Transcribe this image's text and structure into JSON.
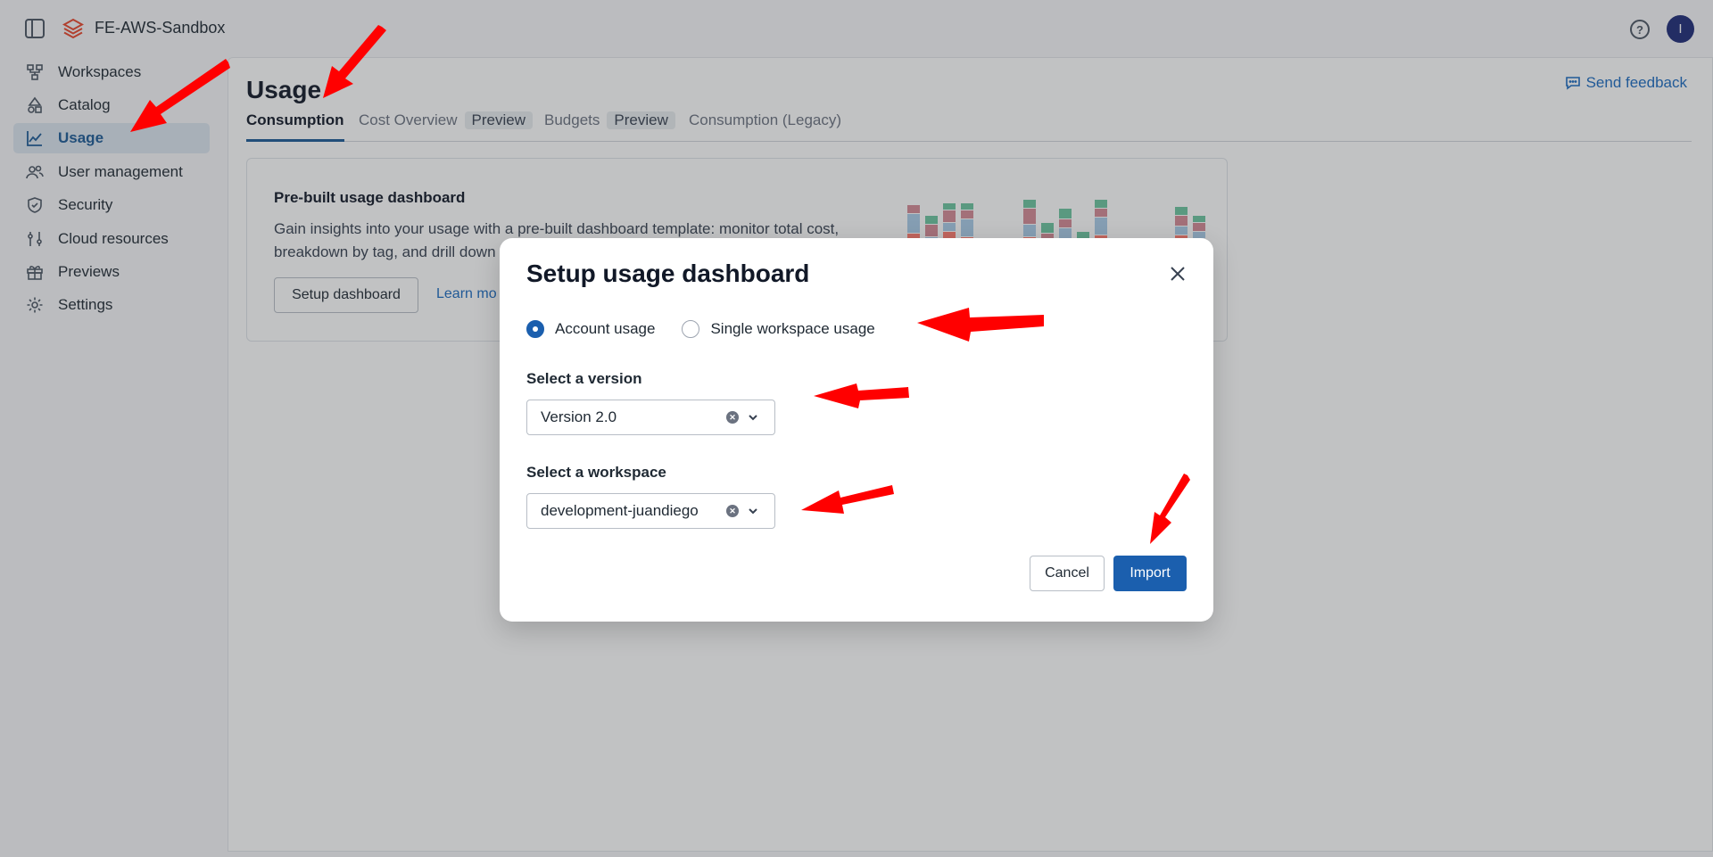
{
  "app": {
    "title": "FE-AWS-Sandbox",
    "avatar_initial": "I",
    "brand_color": "#e8452c",
    "accent_color": "#1b5fae",
    "icons": {
      "panel": "sidebar-toggle-icon",
      "logo": "databricks-logo-icon",
      "help": "help-circle-icon"
    }
  },
  "sidebar": {
    "items": [
      {
        "label": "Workspaces",
        "icon": "workspaces-icon",
        "active": false
      },
      {
        "label": "Catalog",
        "icon": "catalog-icon",
        "active": false
      },
      {
        "label": "Usage",
        "icon": "usage-chart-icon",
        "active": true
      },
      {
        "label": "User management",
        "icon": "users-icon",
        "active": false
      },
      {
        "label": "Security",
        "icon": "shield-icon",
        "active": false
      },
      {
        "label": "Cloud resources",
        "icon": "sliders-icon",
        "active": false
      },
      {
        "label": "Previews",
        "icon": "gift-icon",
        "active": false
      },
      {
        "label": "Settings",
        "icon": "gear-icon",
        "active": false
      }
    ]
  },
  "main": {
    "title": "Usage",
    "send_feedback": "Send feedback",
    "tabs": [
      {
        "label": "Consumption",
        "pill": "",
        "active": true
      },
      {
        "label": "Cost Overview",
        "pill": "Preview",
        "active": false
      },
      {
        "label": "Budgets",
        "pill": "Preview",
        "active": false
      },
      {
        "label": "Consumption (Legacy)",
        "pill": "",
        "active": false
      }
    ],
    "card": {
      "title": "Pre-built usage dashboard",
      "description_line1": "Gain insights into your usage with a pre-built dashboard template: monitor total cost,",
      "description_line2": "breakdown by tag, and drill down",
      "setup_button": "Setup dashboard",
      "learn_more": "Learn mo"
    }
  },
  "modal": {
    "title": "Setup usage dashboard",
    "radio_options": [
      {
        "label": "Account usage",
        "checked": true
      },
      {
        "label": "Single workspace usage",
        "checked": false
      }
    ],
    "version": {
      "label": "Select a version",
      "value": "Version 2.0"
    },
    "workspace": {
      "label": "Select a workspace",
      "value": "development-juandiego"
    },
    "cancel_label": "Cancel",
    "import_label": "Import"
  },
  "annotation_color": "#ff0000"
}
